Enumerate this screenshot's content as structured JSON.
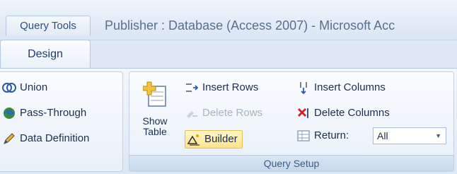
{
  "titlebar": {
    "context_tab": "Query Tools",
    "app_title": "Publisher : Database (Access 2007) - Microsoft Acc"
  },
  "ribbon": {
    "active_tab": "Design",
    "query_type_group": {
      "items": [
        "Union",
        "Pass-Through",
        "Data Definition"
      ]
    },
    "query_setup_group": {
      "label": "Query Setup",
      "show_table": {
        "line1": "Show",
        "line2": "Table"
      },
      "insert_rows": "Insert Rows",
      "delete_rows": "Delete Rows",
      "builder": "Builder",
      "insert_columns": "Insert Columns",
      "delete_columns": "Delete Columns",
      "return_label": "Return:",
      "return_value": "All"
    }
  }
}
